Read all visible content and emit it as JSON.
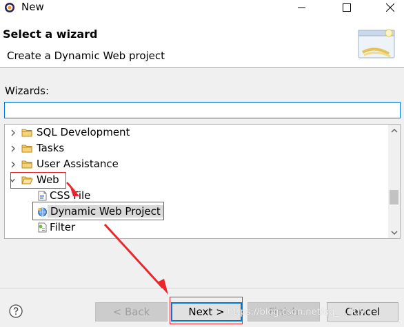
{
  "window": {
    "title": "New",
    "minimize_icon": "minimize-icon",
    "maximize_icon": "maximize-icon"
  },
  "header": {
    "title": "Select a wizard",
    "subtitle": "Create a Dynamic Web project"
  },
  "wizards": {
    "label": "Wizards:",
    "filter_value": "",
    "items": [
      {
        "label": "SQL Development",
        "type": "folder",
        "expanded": false
      },
      {
        "label": "Tasks",
        "type": "folder",
        "expanded": false
      },
      {
        "label": "User Assistance",
        "type": "folder",
        "expanded": false
      },
      {
        "label": "Web",
        "type": "folder",
        "expanded": true
      },
      {
        "label": "CSS File",
        "type": "css-file"
      },
      {
        "label": "Dynamic Web Project",
        "type": "web-project",
        "selected": true
      },
      {
        "label": "Filter",
        "type": "filter"
      }
    ]
  },
  "buttons": {
    "back": "< Back",
    "next": "Next >",
    "finish": "Finish",
    "cancel": "Cancel"
  },
  "watermark": "https://blog.csdn.net/qq_...609",
  "colors": {
    "accent": "#0078d7",
    "annotation": "#e8262b",
    "selection": "#d9d9d9"
  }
}
